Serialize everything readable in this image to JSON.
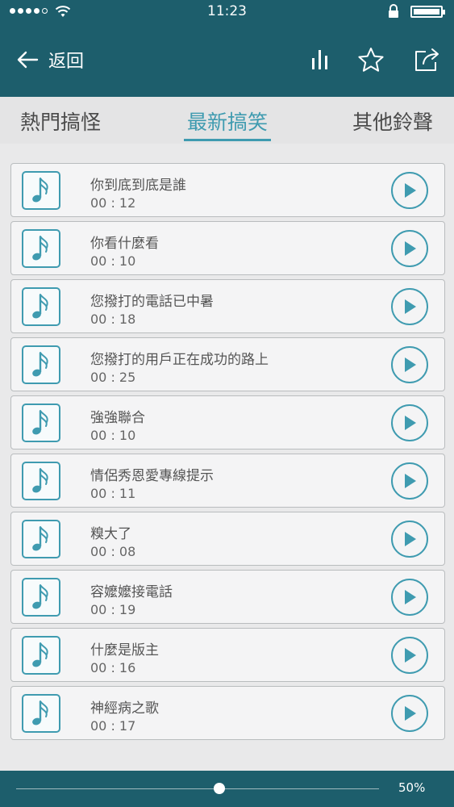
{
  "status_bar": {
    "time": "11:23",
    "signal_dots_filled": 4,
    "signal_dots_total": 5,
    "wifi_icon": "wifi-icon",
    "lock_icon": "lock-icon",
    "battery_icon": "battery-icon"
  },
  "nav": {
    "back_label": "返回",
    "back_icon": "back-arrow-icon",
    "actions": [
      "equalizer-icon",
      "star-icon",
      "share-icon"
    ]
  },
  "tabs": [
    {
      "label": "熱門搞怪",
      "active": false
    },
    {
      "label": "最新搞笑",
      "active": true
    },
    {
      "label": "其他鈴聲",
      "active": false
    }
  ],
  "ringtones": [
    {
      "title": "你到底到底是誰",
      "duration": "00 : 12"
    },
    {
      "title": "你看什麼看",
      "duration": "00 : 10"
    },
    {
      "title": "您撥打的電話已中暑",
      "duration": "00 : 18"
    },
    {
      "title": "您撥打的用戶正在成功的路上",
      "duration": "00 : 25"
    },
    {
      "title": "強強聯合",
      "duration": "00 : 10"
    },
    {
      "title": "情侶秀恩愛專線提示",
      "duration": "00 : 11"
    },
    {
      "title": "糗大了",
      "duration": "00 : 08"
    },
    {
      "title": "容嬤嬤接電話",
      "duration": "00 : 19"
    },
    {
      "title": "什麼是版主",
      "duration": "00 : 16"
    },
    {
      "title": "神經病之歌",
      "duration": "00 : 17"
    }
  ],
  "volume": {
    "label": "50%",
    "value": 0.56
  },
  "colors": {
    "header": "#1d5e6c",
    "accent": "#3f9bb0",
    "background": "#e9e9ea"
  }
}
